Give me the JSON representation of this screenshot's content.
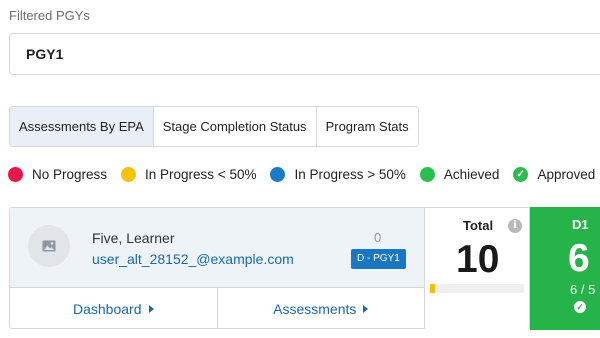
{
  "filter": {
    "label": "Filtered PGYs",
    "selected_value": "PGY1"
  },
  "tabs": [
    {
      "label": "Assessments By EPA",
      "active": true
    },
    {
      "label": "Stage Completion Status",
      "active": false
    },
    {
      "label": "Program Stats",
      "active": false
    }
  ],
  "legend": [
    {
      "label": "No Progress",
      "color": "#e8174a",
      "icon": "dot"
    },
    {
      "label": "In Progress < 50%",
      "color": "#f5c211",
      "icon": "dot"
    },
    {
      "label": "In Progress > 50%",
      "color": "#1a7bc8",
      "icon": "dot"
    },
    {
      "label": "Achieved",
      "color": "#2cbd51",
      "icon": "dot"
    },
    {
      "label": "Approved",
      "color": "#2cbd51",
      "icon": "check-circle"
    }
  ],
  "learner": {
    "name": "Five, Learner",
    "email": "user_alt_28152_@example.com",
    "count": "0",
    "stage_badge": "D - PGY1",
    "links": {
      "dashboard": "Dashboard",
      "assessments": "Assessments"
    },
    "total": {
      "label": "Total",
      "value": "10",
      "progress_fraction": 0.05,
      "progress_color": "#f1bf0b"
    },
    "stage": {
      "code": "D1",
      "value": "6",
      "ratio": "6 / 5",
      "color": "#26b34a"
    }
  }
}
